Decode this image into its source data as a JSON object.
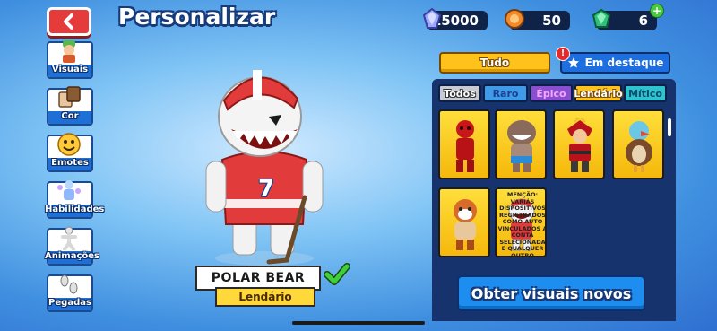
{
  "header": {
    "title": "Personalizar",
    "back_icon": "chevron-left-icon",
    "currencies": [
      {
        "name": "gems",
        "icon": "gem-icon",
        "value": "15000"
      },
      {
        "name": "tokens",
        "icon": "token-icon",
        "value": "50"
      },
      {
        "name": "emeralds",
        "icon": "emerald-icon",
        "value": "6"
      }
    ]
  },
  "sidebar": {
    "items": [
      {
        "label": "Visuais",
        "icon": "character-icon"
      },
      {
        "label": "Cor",
        "icon": "color-swatch-icon"
      },
      {
        "label": "Emotes",
        "icon": "smiley-icon"
      },
      {
        "label": "Habilidades",
        "icon": "ability-icon"
      },
      {
        "label": "Animações",
        "icon": "animation-icon"
      },
      {
        "label": "Pegadas",
        "icon": "footprints-icon"
      }
    ]
  },
  "character": {
    "name": "POLAR BEAR",
    "rarity": "Lendário",
    "jersey_number": "7"
  },
  "filters": {
    "all_label": "Tudo",
    "featured_label": "Em destaque",
    "tabs": [
      "Todos",
      "Raro",
      "Épico",
      "Lendário",
      "Mítico"
    ],
    "active_tab": "Lendário"
  },
  "grid": {
    "items": [
      {
        "name": "red-skeleton-skin"
      },
      {
        "name": "shark-skin"
      },
      {
        "name": "samurai-skin"
      },
      {
        "name": "bird-skin"
      },
      {
        "name": "red-panda-skin"
      },
      {
        "name": "polar-bear-skin"
      }
    ],
    "overlay_text": "MENÇÃO: VARIÁS DISPOSITIVOS REGISTRADOS COMO AUTO VINCULADOS A CONTA SELECIONADA E QUALQUER OUTRO"
  },
  "actions": {
    "get_skins_label": "Obter visuais novos"
  },
  "colors": {
    "accent_yellow": "#ffd83a",
    "panel_navy": "#17336d",
    "button_blue": "#1d8df0",
    "back_red": "#e63b3b"
  }
}
